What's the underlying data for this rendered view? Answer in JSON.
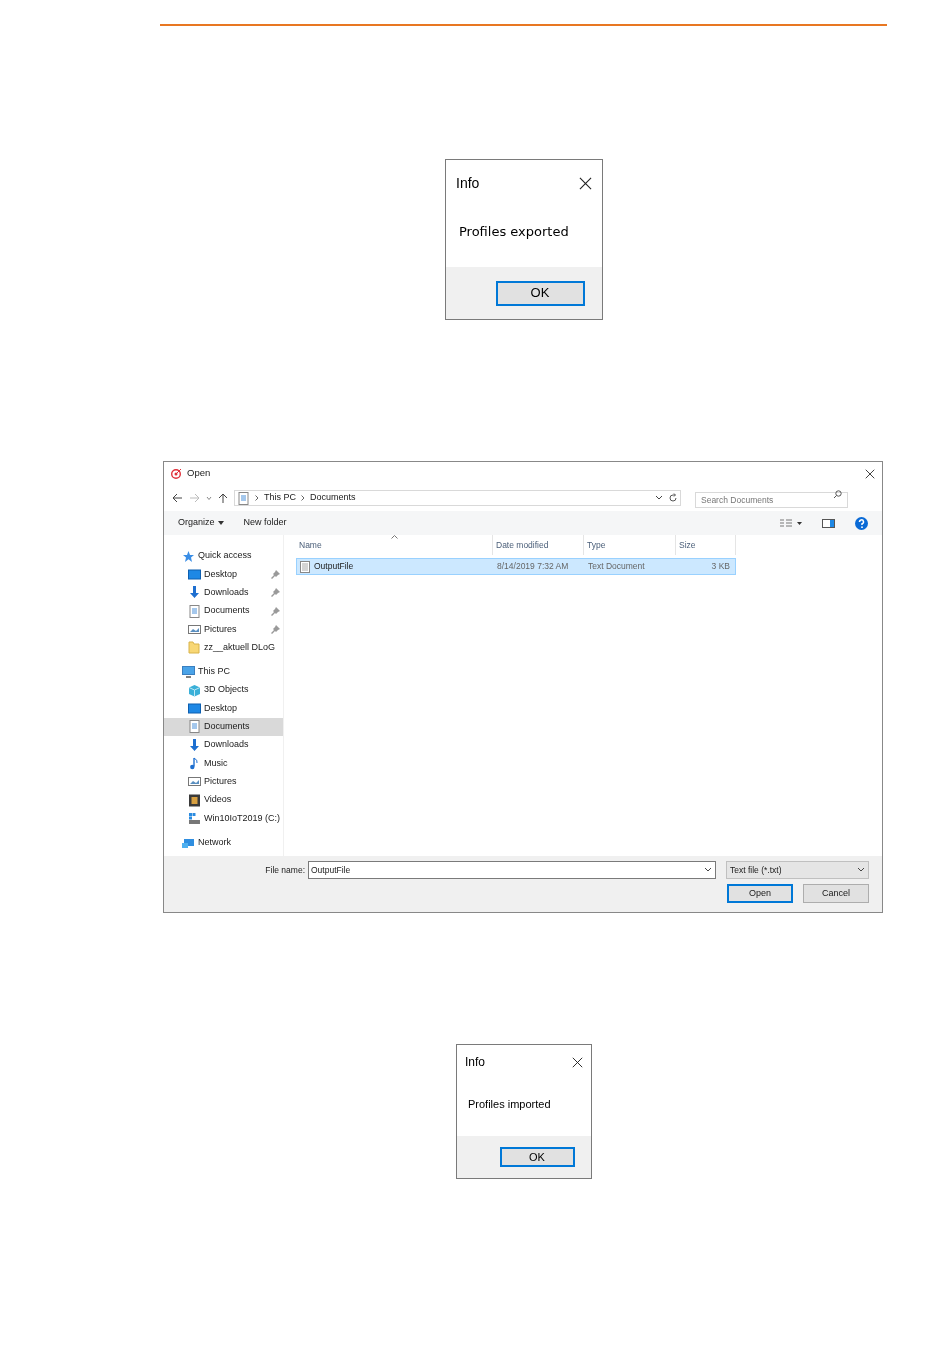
{
  "export_dialog": {
    "title": "Info",
    "message": "Profiles exported",
    "button": "OK"
  },
  "open_dialog": {
    "title": "Open",
    "path": [
      "This PC",
      "Documents"
    ],
    "search": {
      "placeholder": "Search Documents"
    },
    "toolbar": [
      "Organize",
      "New folder"
    ],
    "sidebar": [
      {
        "label": "Quick access",
        "kind": "star",
        "selected": false,
        "children": [
          {
            "label": "Desktop",
            "kind": "desktop",
            "pinned": true,
            "selected": false
          },
          {
            "label": "Downloads",
            "kind": "download",
            "pinned": true,
            "selected": false
          },
          {
            "label": "Documents",
            "kind": "document",
            "pinned": true,
            "selected": false
          },
          {
            "label": "Pictures",
            "kind": "picture",
            "pinned": true,
            "selected": false
          },
          {
            "label": "zz__aktuell DLoG",
            "kind": "folder",
            "pinned": false,
            "selected": false
          }
        ]
      },
      {
        "label": "This PC",
        "kind": "pc",
        "selected": false,
        "children": [
          {
            "label": "3D Objects",
            "kind": "cube",
            "pinned": false,
            "selected": false
          },
          {
            "label": "Desktop",
            "kind": "desktop",
            "pinned": false,
            "selected": false
          },
          {
            "label": "Documents",
            "kind": "document",
            "pinned": false,
            "selected": true
          },
          {
            "label": "Downloads",
            "kind": "download",
            "pinned": false,
            "selected": false
          },
          {
            "label": "Music",
            "kind": "music",
            "pinned": false,
            "selected": false
          },
          {
            "label": "Pictures",
            "kind": "picture",
            "pinned": false,
            "selected": false
          },
          {
            "label": "Videos",
            "kind": "video",
            "pinned": false,
            "selected": false
          },
          {
            "label": "Win10IoT2019 (C:)",
            "kind": "drive",
            "pinned": false,
            "selected": false
          }
        ]
      },
      {
        "label": "Network",
        "kind": "network",
        "selected": false
      }
    ],
    "columns": [
      "Name",
      "Date modified",
      "Type",
      "Size"
    ],
    "rows": [
      {
        "name": "OutputFile",
        "date": "8/14/2019 7:32 AM",
        "type": "Text Document",
        "size": "3 KB",
        "selected": true
      }
    ],
    "file_name_label": "File name:",
    "file_name": "OutputFile",
    "file_type": "Text file (*.txt)",
    "buttons": [
      "Open",
      "Cancel"
    ]
  },
  "import_dialog": {
    "title": "Info",
    "message": "Profiles imported",
    "button": "OK"
  }
}
